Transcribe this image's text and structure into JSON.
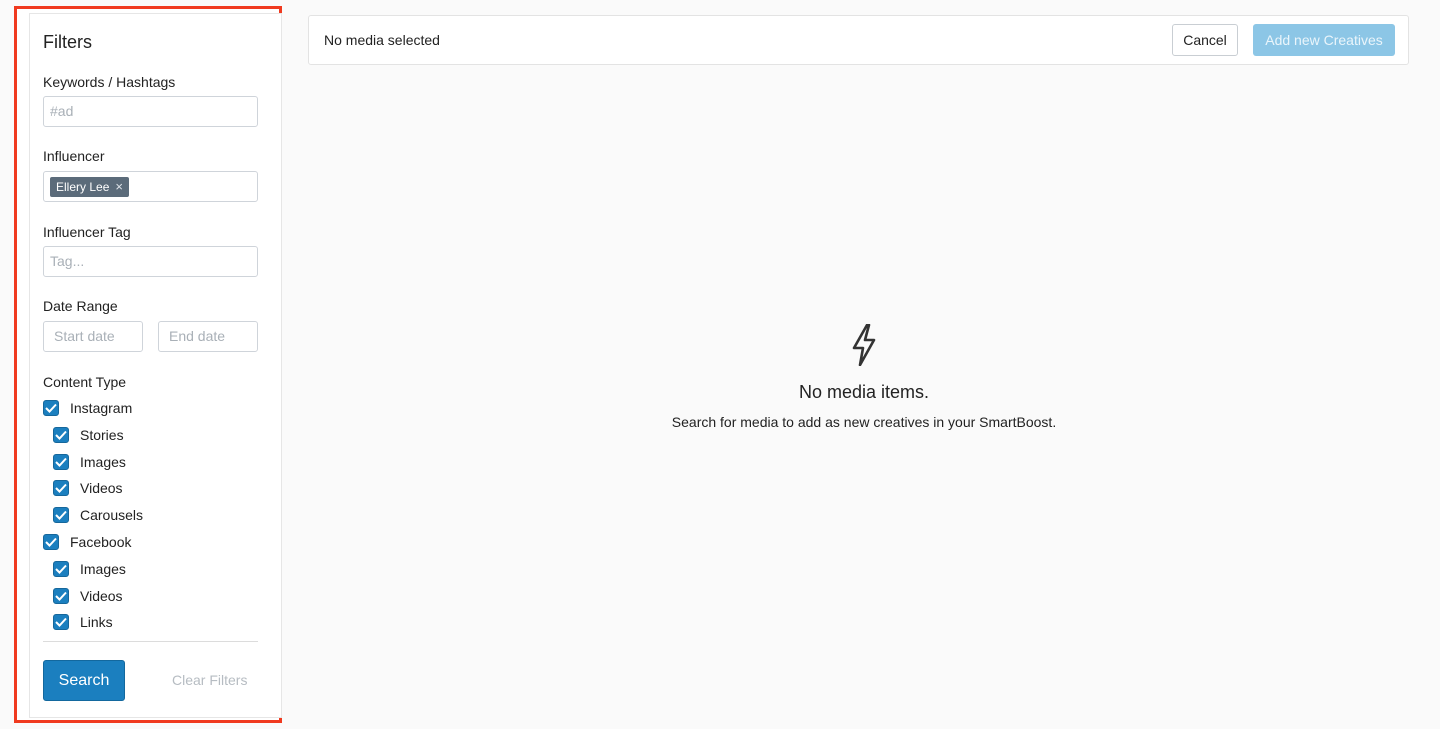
{
  "filters": {
    "title": "Filters",
    "keywords": {
      "label": "Keywords / Hashtags",
      "placeholder": "#ad"
    },
    "influencer": {
      "label": "Influencer",
      "chip": "Ellery Lee",
      "chip_remove": "×"
    },
    "influencer_tag": {
      "label": "Influencer Tag",
      "placeholder": "Tag..."
    },
    "date_range": {
      "label": "Date Range",
      "start_placeholder": "Start date",
      "end_placeholder": "End date"
    },
    "content_type": {
      "label": "Content Type",
      "instagram": {
        "label": "Instagram",
        "checked": true,
        "children": [
          {
            "label": "Stories",
            "checked": true
          },
          {
            "label": "Images",
            "checked": true
          },
          {
            "label": "Videos",
            "checked": true
          },
          {
            "label": "Carousels",
            "checked": true
          }
        ]
      },
      "facebook": {
        "label": "Facebook",
        "checked": true,
        "children": [
          {
            "label": "Images",
            "checked": true
          },
          {
            "label": "Videos",
            "checked": true
          },
          {
            "label": "Links",
            "checked": true
          }
        ]
      }
    },
    "search_label": "Search",
    "clear_label": "Clear Filters"
  },
  "topbar": {
    "status": "No media selected",
    "cancel_label": "Cancel",
    "add_label": "Add new Creatives"
  },
  "empty_state": {
    "icon": "lightning-icon",
    "title": "No media items.",
    "subtitle": "Search for media to add as new creatives in your SmartBoost."
  },
  "colors": {
    "accent": "#1b7fbf",
    "highlight_border": "#f03a1f",
    "disabled_button": "#8cc6e6",
    "chip": "#5b6b7a"
  }
}
